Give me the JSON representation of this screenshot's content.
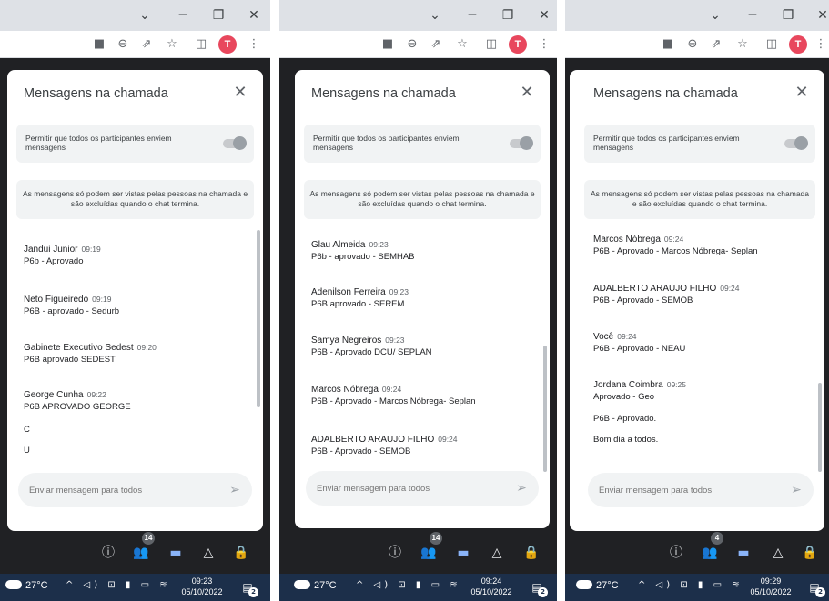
{
  "panels": [
    {
      "panel_title": "Mensagens na chamada",
      "permission_text": "Permitir que todos os participantes enviem mensagens",
      "info_text": "As mensagens só podem ser vistas pelas pessoas na chamada e são excluídas quando o chat termina.",
      "compose_placeholder": "Enviar mensagem para todos",
      "participants_count": "14",
      "messages": [
        {
          "sender": "Jandui Junior",
          "time": "09:19",
          "text": "P6b - Aprovado"
        },
        {
          "sender": "Neto Figueiredo",
          "time": "09:19",
          "text": "P6B - aprovado - Sedurb"
        },
        {
          "sender": "Gabinete Executivo Sedest",
          "time": "09:20",
          "text": "P6B aprovado SEDEST"
        },
        {
          "sender": "George Cunha",
          "time": "09:22",
          "text": "P6B APROVADO GEORGE"
        },
        {
          "sender": "",
          "time": "",
          "text": "C"
        },
        {
          "sender": "",
          "time": "",
          "text": "U"
        }
      ],
      "taskbar": {
        "temperature": "27°C",
        "time": "09:23",
        "date": "05/10/2022",
        "notifications": "2"
      }
    },
    {
      "panel_title": "Mensagens na chamada",
      "permission_text": "Permitir que todos os participantes enviem mensagens",
      "info_text": "As mensagens só podem ser vistas pelas pessoas na chamada e são excluídas quando o chat termina.",
      "compose_placeholder": "Enviar mensagem para todos",
      "participants_count": "14",
      "messages": [
        {
          "sender": "Glau Almeida",
          "time": "09:23",
          "text": "P6b - aprovado - SEMHAB"
        },
        {
          "sender": "Adenilson Ferreira",
          "time": "09:23",
          "text": "P6B aprovado - SEREM"
        },
        {
          "sender": "Samya Negreiros",
          "time": "09:23",
          "text": "P6B - Aprovado DCU/ SEPLAN"
        },
        {
          "sender": "Marcos Nóbrega",
          "time": "09:24",
          "text": "P6B - Aprovado - Marcos Nóbrega- Seplan"
        },
        {
          "sender": "ADALBERTO ARAUJO FILHO",
          "time": "09:24",
          "text": "P6B - Aprovado - SEMOB"
        }
      ],
      "taskbar": {
        "temperature": "27°C",
        "time": "09:24",
        "date": "05/10/2022",
        "notifications": "2"
      }
    },
    {
      "panel_title": "Mensagens na chamada",
      "permission_text": "Permitir que todos os participantes enviem mensagens",
      "info_text": "As mensagens só podem ser vistas pelas pessoas na chamada e são excluídas quando o chat termina.",
      "compose_placeholder": "Enviar mensagem para todos",
      "participants_count": "4",
      "messages": [
        {
          "sender": "Marcos Nóbrega",
          "time": "09:24",
          "text": "P6B - Aprovado - Marcos Nóbrega- Seplan"
        },
        {
          "sender": "ADALBERTO ARAUJO FILHO",
          "time": "09:24",
          "text": "P6B - Aprovado - SEMOB"
        },
        {
          "sender": "Você",
          "time": "09:24",
          "text": "P6B - Aprovado - NEAU"
        },
        {
          "sender": "Jordana Coimbra",
          "time": "09:25",
          "text": "Aprovado - Geo"
        },
        {
          "sender": "",
          "time": "",
          "text": "P6B - Aprovado."
        },
        {
          "sender": "",
          "time": "",
          "text": "Bom dia a todos."
        }
      ],
      "taskbar": {
        "temperature": "27°C",
        "time": "09:29",
        "date": "05/10/2022",
        "notifications": "2"
      }
    }
  ],
  "browser": {
    "avatar_letter": "T"
  },
  "icons": {
    "minimize": "minimize-icon",
    "restore": "restore-icon",
    "close": "close-icon",
    "camera": "camera-icon",
    "zoom": "zoom-icon",
    "share": "share-icon",
    "star": "star-icon",
    "sidepanel": "side-panel-icon",
    "menu": "more-vert-icon",
    "info": "info-icon",
    "people": "people-icon",
    "chat": "chat-icon",
    "activities": "activities-icon",
    "lock": "host-controls-icon",
    "send": "send-icon"
  },
  "colors": {
    "meet_bg": "#202124",
    "accent": "#8ab4f8",
    "taskbar": "#1c2f4a",
    "avatar": "#e8475d"
  }
}
